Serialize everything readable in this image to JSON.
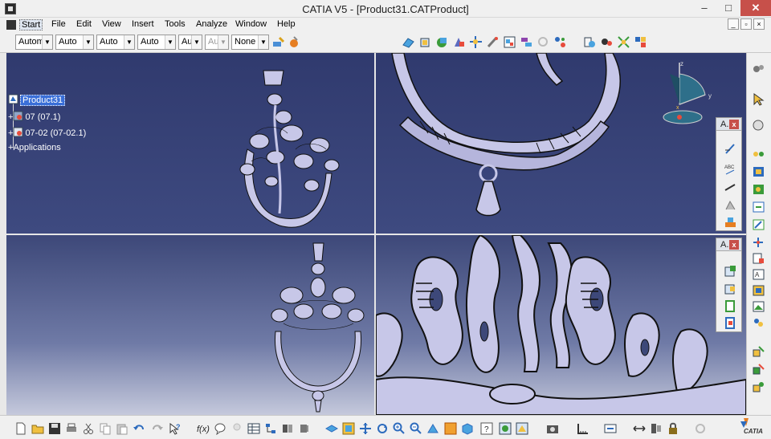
{
  "window": {
    "title": "CATIA V5 - [Product31.CATProduct]",
    "min": "–",
    "max": "□",
    "close": "✕"
  },
  "menu": [
    "Start",
    "File",
    "Edit",
    "View",
    "Insert",
    "Tools",
    "Analyze",
    "Window",
    "Help"
  ],
  "mdi": [
    "_",
    "▫",
    "×"
  ],
  "toolbar": {
    "combos": [
      {
        "value": "Automa"
      },
      {
        "value": "Auto"
      },
      {
        "value": "Auto"
      },
      {
        "value": "Auto"
      },
      {
        "value": "Aut"
      },
      {
        "value": "Aut",
        "disabled": true
      },
      {
        "value": "None"
      }
    ]
  },
  "tree": {
    "root": "Product31",
    "children": [
      "07 (07.1)",
      "07-02 (07-02.1)"
    ],
    "applications": "Applications"
  },
  "panels": [
    {
      "title": "A.",
      "close": "x"
    },
    {
      "title": "A.",
      "close": "x"
    }
  ],
  "compass": {
    "z": "z",
    "y": "y",
    "x": "x"
  },
  "logo": {
    "text": "CATIA"
  },
  "colors": {
    "viewport_top": "#303a6e",
    "viewport_bottom": "#c5c9dc",
    "model_fill": "#c7c7e8",
    "model_edge": "#111111",
    "selection": "#3a6fd8"
  }
}
